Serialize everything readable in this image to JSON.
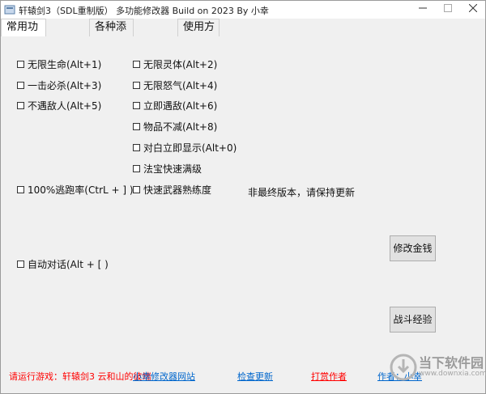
{
  "window": {
    "title": "轩辕剑3（SDL重制版） 多功能修改器  Build on 2023 By 小幸",
    "minimize_icon": "minimize-icon",
    "maximize_icon": "maximize-icon",
    "close_icon": "close-icon"
  },
  "tabs": [
    {
      "label": "常用功能",
      "active": true
    },
    {
      "label": "各种添加",
      "active": false
    },
    {
      "label": "使用方法",
      "active": false
    }
  ],
  "checkboxes": {
    "left": [
      {
        "label": "无限生命(Alt+1)",
        "checked": false
      },
      {
        "label": "一击必杀(Alt+3)",
        "checked": false
      },
      {
        "label": "不遇敌人(Alt+5)",
        "checked": false
      },
      {
        "label": "100%逃跑率(CtrL + ] )",
        "checked": false
      },
      {
        "label": "自动对话(Alt + [ )",
        "checked": false
      }
    ],
    "right": [
      {
        "label": "无限灵体(Alt+2)",
        "checked": false
      },
      {
        "label": "无限怒气(Alt+4)",
        "checked": false
      },
      {
        "label": "立即遇敌(Alt+6)",
        "checked": false
      },
      {
        "label": "物品不减(Alt+8)",
        "checked": false
      },
      {
        "label": "对白立即显示(Alt+0)",
        "checked": false
      },
      {
        "label": "法宝快速满级",
        "checked": false
      },
      {
        "label": "快速武器熟练度",
        "checked": false
      }
    ]
  },
  "notice": "非最终版本，请保持更新",
  "buttons": {
    "money": "修改金钱",
    "exp": "战斗经验"
  },
  "footer": {
    "running_game": "请运行游戏：轩辕剑3 云和山的彼端",
    "site_link": "小幸修改器网站",
    "check_update": "检查更新",
    "tip_author": "打赏作者",
    "author": "作者：小幸"
  },
  "watermark": {
    "line1": "当下软件园",
    "line2": "www.downxia.com"
  },
  "colors": {
    "red_text": "#ff0000",
    "link_blue": "#0066cc",
    "window_bg": "#f0f0f0"
  }
}
